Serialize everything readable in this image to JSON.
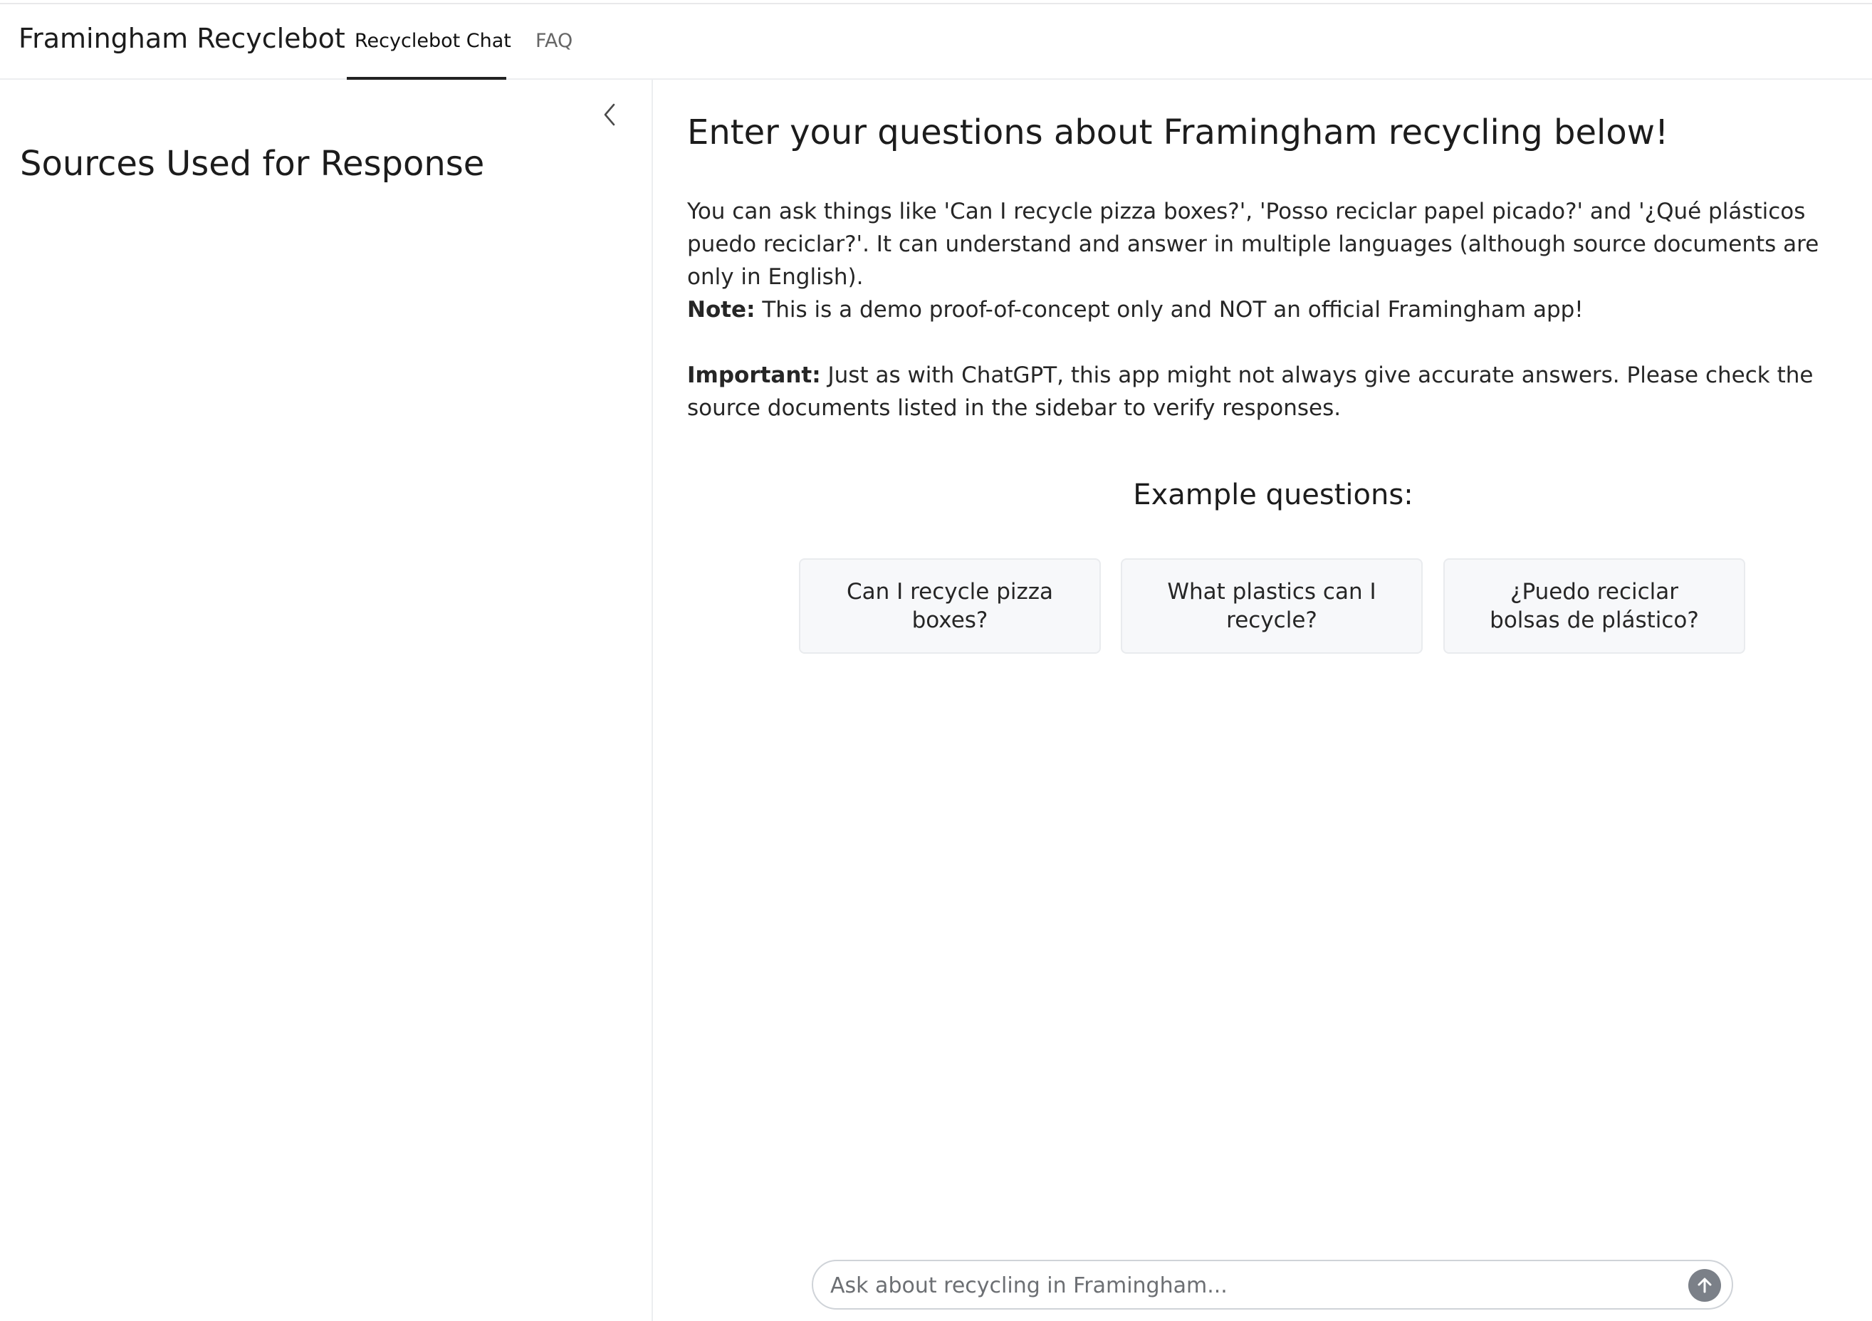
{
  "app": {
    "brand": "Framingham Recyclebot"
  },
  "nav": {
    "tabs": [
      {
        "label": "Recyclebot Chat",
        "active": true
      },
      {
        "label": "FAQ",
        "active": false
      }
    ]
  },
  "sidebar": {
    "collapse_icon": "chevron-left-icon",
    "title": "Sources Used for Response"
  },
  "main": {
    "headline": "Enter your questions about Framingham recycling below!",
    "intro": "You can ask things like 'Can I recycle pizza boxes?', 'Posso reciclar papel picado?' and '¿Qué plásticos puedo reciclar?'. It can understand and answer in multiple languages (although source documents are only in English).",
    "note_label": "Note:",
    "note_text": " This is a demo proof-of-concept only and NOT an official Framingham app!",
    "important_label": "Important:",
    "important_text": " Just as with ChatGPT, this app might not always give accurate answers. Please check the source documents listed in the sidebar to verify responses.",
    "examples_heading": "Example questions:",
    "examples": [
      "Can I recycle pizza boxes?",
      "What plastics can I recycle?",
      "¿Puedo reciclar bolsas de plástico?"
    ]
  },
  "chat": {
    "placeholder": "Ask about recycling in Framingham...",
    "value": "",
    "send_icon": "arrow-up-icon"
  },
  "colors": {
    "active_tab_underline": "#222222",
    "send_button": "#7b8088",
    "example_bg": "#f7f8fa"
  }
}
